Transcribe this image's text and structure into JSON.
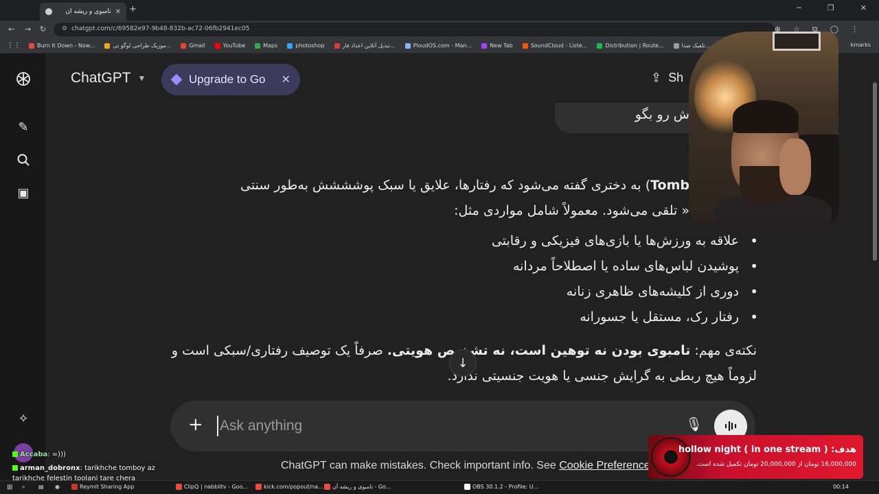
{
  "browser": {
    "tab_title": "تامبوی و ریشه آن",
    "url": "chatgpt.com/c/69582e97-9b48-832b-ac72-06fb2941ec05",
    "bookmarks": [
      {
        "label": "Burn It Down - Now...",
        "color": "#e34b3c"
      },
      {
        "label": "موزیک طراحی لوگو تی...",
        "color": "#f2a71d"
      },
      {
        "label": "Gmail",
        "color": "#ea4335"
      },
      {
        "label": "YouTube",
        "color": "#ff0000"
      },
      {
        "label": "Maps",
        "color": "#34a853"
      },
      {
        "label": "photoshop",
        "color": "#31a8ff"
      },
      {
        "label": "تبدیل آنلاین اعداد فار...",
        "color": "#d83b3b"
      },
      {
        "label": "PloudOS.com - Man...",
        "color": "#8ab4f8"
      },
      {
        "label": "New Tab",
        "color": "#a142f4"
      },
      {
        "label": "SoundCloud - Liste...",
        "color": "#ff5500"
      },
      {
        "label": "Distribution | Route...",
        "color": "#1db954"
      },
      {
        "label": "تلفیک صدا...",
        "color": "#9e9e9e"
      }
    ],
    "bookmarks_right": "kmarks"
  },
  "header": {
    "brand": "ChatGPT",
    "upgrade_label": "Upgrade to Go",
    "share_label": "Sh"
  },
  "chat": {
    "user_message": "ش رو بگو",
    "para1_line1_bold": "Tomb",
    "para1_line1": ") به دختری گفته می‌شود که رفتارها، علایق یا سبک پوشششش به‌طور سنتی",
    "para1_line2": "« تلقی می‌شود. معمولاً شامل مواردی مثل:",
    "bullets": [
      "علاقه به ورزش‌ها یا بازی‌های فیزیکی و رقابتی",
      "پوشیدن لباس‌های ساده یا اصطلاحاً مردانه",
      "دوری از کلیشه‌های ظاهری زنانه",
      "رفتار رک، مستقل یا جسورانه"
    ],
    "note_prefix": "نکته‌ی مهم: ",
    "note_bold": "تامبوی بودن نه توهین است، نه تشخیص هویتی.",
    "note_rest": " صرفاً یک توصیف رفتاری/سبکی است و لزوماً هیچ ربطی به گرایش جنسی یا هویت جنسیتی ندارد."
  },
  "composer": {
    "placeholder": "Ask anything"
  },
  "footer": {
    "text": "ChatGPT can make mistakes. Check important info. See ",
    "link": "Cookie Preferences",
    "end": "."
  },
  "stream": {
    "donation_goal": "هدف: ( hollow night ( in one stream",
    "donation_progress": "16,000,000 تومان از 20,000,000 تومان تکمیل شده است.",
    "chat": [
      {
        "user": "Accaba",
        "message": ": =)))"
      },
      {
        "user": "arman_dobronx",
        "message": ": tarikhche tomboy az"
      },
      {
        "user": "",
        "message": "tarikhche felestin toolani tare chera"
      }
    ]
  },
  "taskbar": {
    "items": [
      {
        "label": "Reymit Sharing App",
        "color": "#c0392b"
      },
      {
        "label": "ClipQ | nabbiltv - Goo...",
        "color": "#e74c3c"
      },
      {
        "label": "kick.com/popout/na...",
        "color": "#e74c3c"
      },
      {
        "label": "تامبوی و ریشه آن - Go...",
        "color": "#e74c3c"
      },
      {
        "label": "OBS 30.1.2 - Profile: U...",
        "color": "#ffffff"
      }
    ],
    "clock": "00:14"
  }
}
